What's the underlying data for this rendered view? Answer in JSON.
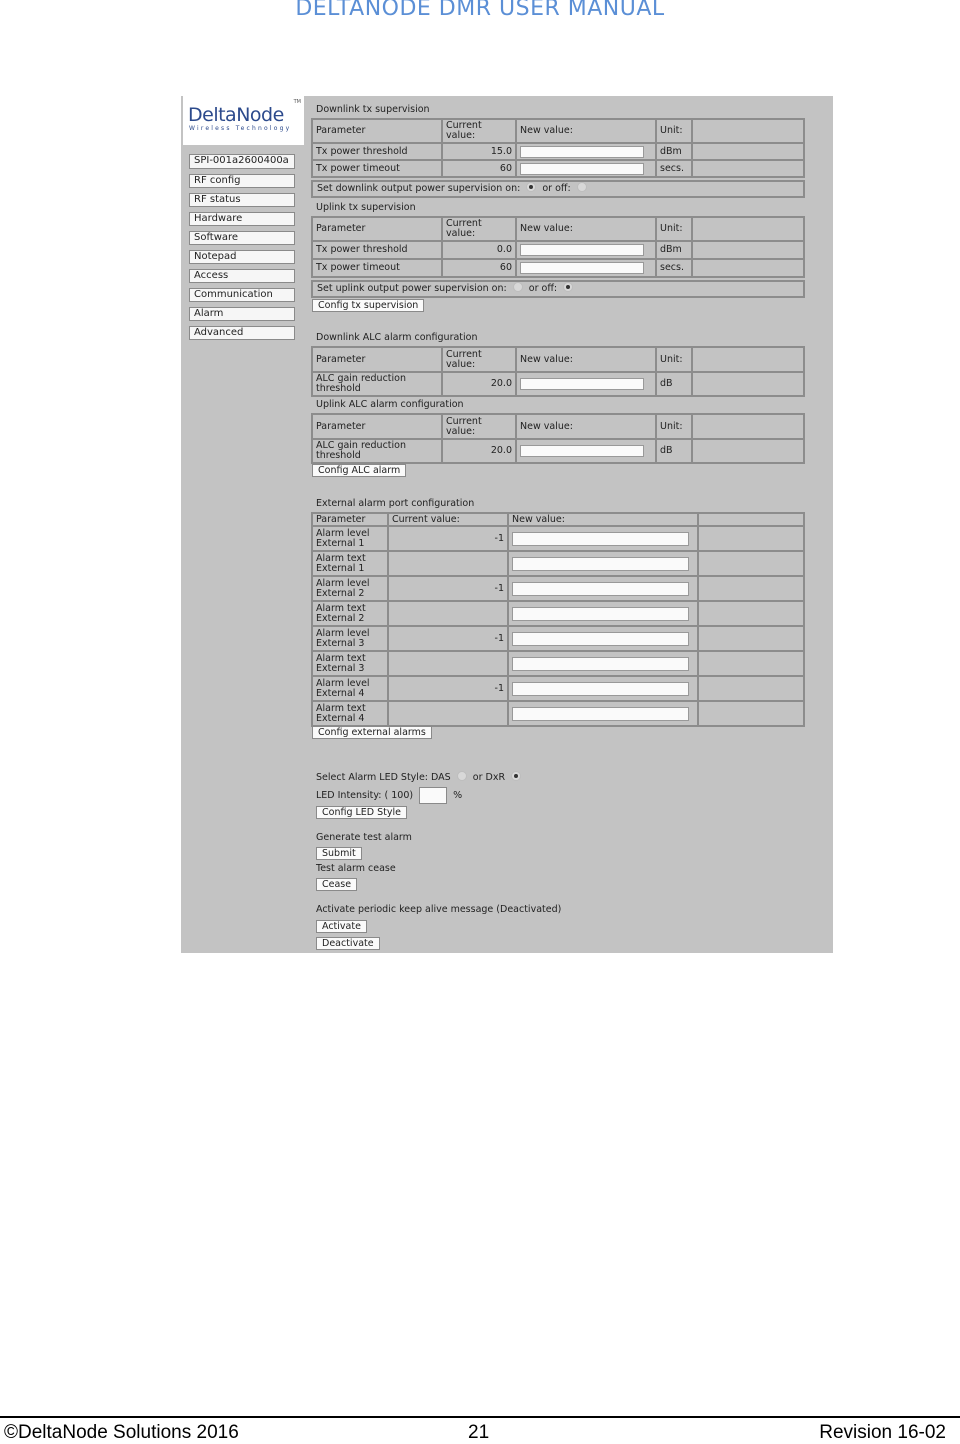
{
  "document": {
    "header": "DELTANODE DMR USER MANUAL",
    "footer": {
      "copyright": "©DeltaNode Solutions 2016",
      "page_number": "21",
      "revision": "Revision 16-02"
    }
  },
  "logo": {
    "brand": "DeltaNode",
    "tm": "TM",
    "tagline": "Wireless Technology"
  },
  "sidebar": {
    "items": [
      {
        "label": "SPI-001a2600400a"
      },
      {
        "label": "RF config"
      },
      {
        "label": "RF status"
      },
      {
        "label": "Hardware"
      },
      {
        "label": "Software"
      },
      {
        "label": "Notepad"
      },
      {
        "label": "Access"
      },
      {
        "label": "Communication"
      },
      {
        "label": "Alarm"
      },
      {
        "label": "Advanced"
      }
    ]
  },
  "columns": {
    "parameter": "Parameter",
    "current_value": "Current value:",
    "new_value": "New value:",
    "unit": "Unit:"
  },
  "downlink_tx": {
    "title": "Downlink tx supervision",
    "rows": [
      {
        "parameter": "Tx power threshold",
        "current": "15.0",
        "new_value": "",
        "unit": "dBm"
      },
      {
        "parameter": "Tx power timeout",
        "current": "60",
        "new_value": "",
        "unit": "secs."
      }
    ],
    "supervision_label": "Set downlink output power supervision on:",
    "off_label": "or off:",
    "supervision_on": true
  },
  "uplink_tx": {
    "title": "Uplink tx supervision",
    "rows": [
      {
        "parameter": "Tx power threshold",
        "current": "0.0",
        "new_value": "",
        "unit": "dBm"
      },
      {
        "parameter": "Tx power timeout",
        "current": "60",
        "new_value": "",
        "unit": "secs."
      }
    ],
    "supervision_label": "Set uplink output power supervision on:",
    "off_label": "or off:",
    "supervision_on": false,
    "button": "Config tx supervision"
  },
  "downlink_alc": {
    "title": "Downlink ALC alarm configuration",
    "rows": [
      {
        "parameter": "ALC gain reduction threshold",
        "current": "20.0",
        "new_value": "",
        "unit": "dB"
      }
    ]
  },
  "uplink_alc": {
    "title": "Uplink ALC alarm configuration",
    "rows": [
      {
        "parameter": "ALC gain reduction threshold",
        "current": "20.0",
        "new_value": "",
        "unit": "dB"
      }
    ],
    "button": "Config ALC alarm"
  },
  "external_alarms": {
    "title": "External alarm port configuration",
    "columns": [
      "Parameter",
      "Current value:",
      "New value:",
      ""
    ],
    "rows": [
      {
        "parameter": "Alarm level External 1",
        "current": "-1",
        "new_value": ""
      },
      {
        "parameter": "Alarm text External 1",
        "current": "",
        "new_value": ""
      },
      {
        "parameter": "Alarm level External 2",
        "current": "-1",
        "new_value": ""
      },
      {
        "parameter": "Alarm text External 2",
        "current": "",
        "new_value": ""
      },
      {
        "parameter": "Alarm level External 3",
        "current": "-1",
        "new_value": ""
      },
      {
        "parameter": "Alarm text External 3",
        "current": "",
        "new_value": ""
      },
      {
        "parameter": "Alarm level External 4",
        "current": "-1",
        "new_value": ""
      },
      {
        "parameter": "Alarm text External 4",
        "current": "",
        "new_value": ""
      }
    ],
    "button": "Config external alarms"
  },
  "led": {
    "style_label": "Select Alarm LED Style: DAS",
    "dxr_label": "or DxR",
    "selected": "DxR",
    "intensity_label": "LED Intensity: ( 100)",
    "intensity_value": "",
    "percent": "%",
    "button": "Config LED Style"
  },
  "test_alarm": {
    "generate_label": "Generate test alarm",
    "submit_button": "Submit",
    "cease_label": "Test alarm cease",
    "cease_button": "Cease"
  },
  "keep_alive": {
    "label": "Activate periodic keep alive message  (Deactivated)",
    "activate_button": "Activate",
    "deactivate_button": "Deactivate"
  }
}
